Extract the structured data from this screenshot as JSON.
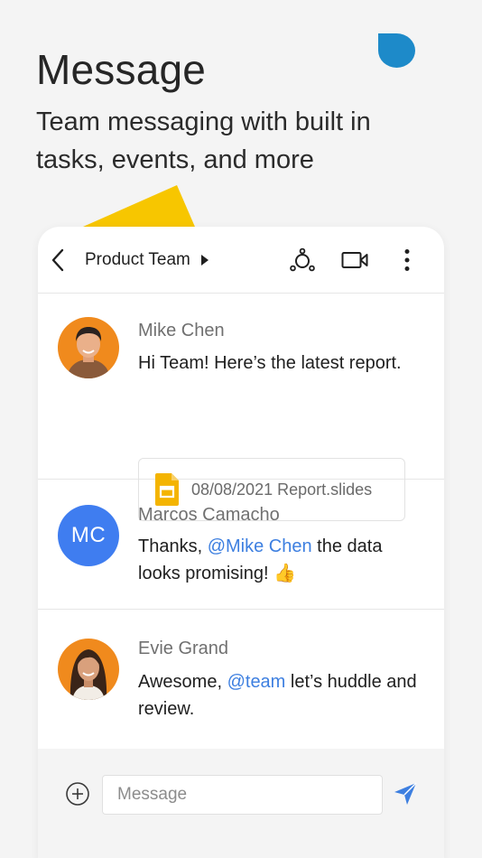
{
  "hero": {
    "title": "Message",
    "subtitle": "Team messaging with built in tasks, events, and more"
  },
  "chat": {
    "title": "Product Team",
    "header_icons": [
      "back-icon",
      "participants-icon",
      "video-call-icon",
      "more-options-icon"
    ]
  },
  "messages": [
    {
      "sender": "Mike Chen",
      "text": "Hi Team! Here’s the latest report.",
      "attachment": {
        "name": "08/08/2021 Report.slides",
        "icon": "slides-file-icon"
      }
    },
    {
      "sender": "Marcos Camacho",
      "initials": "MC",
      "text_before": "Thanks, ",
      "mention": "@Mike Chen",
      "text_after": " the data looks promising! 👍"
    },
    {
      "sender": "Evie Grand",
      "text_before": "Awesome, ",
      "mention": "@team",
      "text_after": " let’s huddle and review."
    }
  ],
  "composer": {
    "placeholder": "Message",
    "value": ""
  },
  "colors": {
    "accent": "#3d7fe0",
    "blob": "#1d8ac9",
    "yellow": "#f7c600",
    "avatar_mc": "#3f7df0"
  }
}
